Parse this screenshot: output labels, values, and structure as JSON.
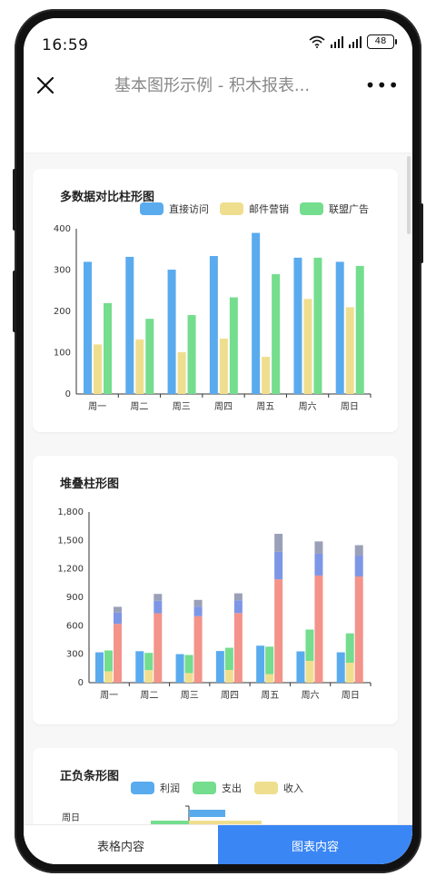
{
  "status": {
    "time": "16:59",
    "battery": "48"
  },
  "nav": {
    "title": "基本图形示例 - 积木报表...",
    "more_label": "•••"
  },
  "colors": {
    "blue": "#5aabee",
    "yellow": "#f0de8f",
    "green": "#74dd8e",
    "red": "#f3938a",
    "indigo": "#7e96e6",
    "slate": "#9aa0b8",
    "tab_active": "#3a86f5"
  },
  "tabs": [
    {
      "label": "表格内容",
      "active": false
    },
    {
      "label": "图表内容",
      "active": true
    }
  ],
  "legend1": [
    "直接访问",
    "邮件营销",
    "联盟广告"
  ],
  "legend3": [
    "利润",
    "支出",
    "收入"
  ],
  "chart_data": [
    {
      "type": "bar",
      "title": "多数据对比柱形图",
      "categories": [
        "周一",
        "周二",
        "周三",
        "周四",
        "周五",
        "周六",
        "周日"
      ],
      "yticks": [
        "0",
        "100",
        "200",
        "300",
        "400"
      ],
      "ylim": [
        0,
        400
      ],
      "legend": "top-right",
      "series": [
        {
          "name": "直接访问",
          "values": [
            320,
            332,
            301,
            334,
            390,
            330,
            320
          ]
        },
        {
          "name": "邮件营销",
          "values": [
            120,
            132,
            101,
            134,
            90,
            230,
            210
          ]
        },
        {
          "name": "联盟广告",
          "values": [
            220,
            182,
            191,
            234,
            290,
            330,
            310
          ]
        }
      ]
    },
    {
      "type": "bar",
      "title": "堆叠柱形图",
      "categories": [
        "周一",
        "周二",
        "周三",
        "周四",
        "周五",
        "周六",
        "周日"
      ],
      "yticks": [
        "0",
        "300",
        "600",
        "900",
        "1,200",
        "1,500",
        "1,800"
      ],
      "ylim": [
        0,
        1800
      ],
      "stack_a": [
        {
          "values": [
            320,
            332,
            301,
            334,
            390,
            330,
            320
          ]
        }
      ],
      "stack_b": [
        {
          "values": [
            120,
            132,
            101,
            134,
            90,
            230,
            210
          ]
        },
        {
          "values": [
            220,
            182,
            191,
            234,
            290,
            330,
            310
          ]
        }
      ],
      "stack_c": [
        {
          "values": [
            620,
            732,
            701,
            734,
            1090,
            1130,
            1120
          ]
        },
        {
          "values": [
            120,
            132,
            101,
            134,
            290,
            230,
            220
          ]
        },
        {
          "values": [
            60,
            72,
            71,
            74,
            190,
            130,
            110
          ]
        }
      ]
    },
    {
      "type": "bar",
      "title": "正负条形图",
      "legend": "top-center",
      "series": [
        {
          "name": "利润",
          "values": [
            200
          ]
        },
        {
          "name": "支出",
          "values": [
            -210
          ]
        },
        {
          "name": "收入",
          "values": [
            400
          ]
        }
      ],
      "categories": [
        "周日"
      ]
    }
  ]
}
